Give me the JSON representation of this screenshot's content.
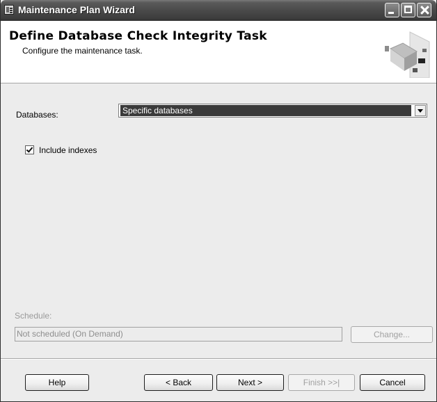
{
  "window": {
    "title": "Maintenance Plan Wizard"
  },
  "header": {
    "title": "Define Database Check Integrity Task",
    "subtitle": "Configure the maintenance task."
  },
  "form": {
    "databases_label": "Databases:",
    "databases_value": "Specific databases",
    "include_indexes_label": "Include indexes",
    "include_indexes_checked": true
  },
  "schedule": {
    "label": "Schedule:",
    "value": "Not scheduled (On Demand)",
    "change_label": "Change..."
  },
  "footer": {
    "help_label": "Help",
    "back_label": "< Back",
    "next_label": "Next >",
    "finish_label": "Finish >>|",
    "cancel_label": "Cancel"
  },
  "icons": {
    "app": "wizard-app-icon",
    "header_graphic": "maintenance-plan-graphic",
    "minimize": "minimize-icon",
    "maximize": "maximize-icon",
    "close": "close-icon",
    "dropdown": "chevron-down-icon",
    "checkbox": "checkmark-icon"
  }
}
